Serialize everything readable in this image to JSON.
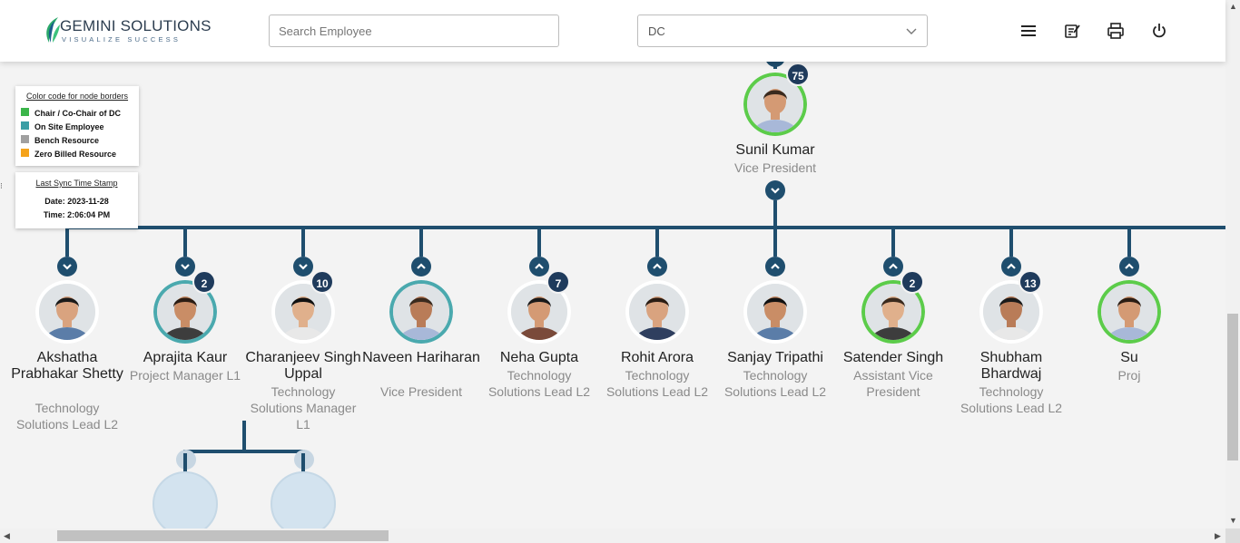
{
  "header": {
    "logo_text": "GEMINI SOLUTIONS",
    "logo_tagline": "VISUALIZE SUCCESS",
    "search_placeholder": "Search Employee",
    "select_value": "DC",
    "icons": [
      "menu-icon",
      "notes-icon",
      "print-icon",
      "power-icon"
    ]
  },
  "legend": {
    "title": "Color code for node borders",
    "items": [
      {
        "label": "Chair / Co-Chair of DC",
        "color": "#3bb54a"
      },
      {
        "label": "On Site Employee",
        "color": "#3a9ea5"
      },
      {
        "label": "Bench Resource",
        "color": "#a0a0a0"
      },
      {
        "label": "Zero Billed Resource",
        "color": "#f5a31a"
      }
    ]
  },
  "sync": {
    "title": "Last Sync Time Stamp",
    "date": "Date: 2023-11-28",
    "time": "Time: 2:06:04 PM"
  },
  "root": {
    "name": "Sunil Kumar",
    "title": "Vice President",
    "count": "75",
    "border": "#5ccc4a"
  },
  "employees": [
    {
      "name": "Akshatha Prabhakar Shetty",
      "title": "Technology Solutions Lead L2",
      "count": "",
      "border": "#ffffff"
    },
    {
      "name": "Aprajita Kaur",
      "title": "Project Manager L1",
      "count": "2",
      "border": "#4aa9ae"
    },
    {
      "name": "Charanjeev Singh Uppal",
      "title": "Technology Solutions Manager L1",
      "count": "10",
      "border": "#ffffff"
    },
    {
      "name": "Naveen Hariharan",
      "title": "Vice President",
      "count": "",
      "border": "#4aa9ae"
    },
    {
      "name": "Neha Gupta",
      "title": "Technology Solutions Lead L2",
      "count": "7",
      "border": "#ffffff"
    },
    {
      "name": "Rohit Arora",
      "title": "Technology Solutions Lead L2",
      "count": "",
      "border": "#ffffff"
    },
    {
      "name": "Sanjay Tripathi",
      "title": "Technology Solutions Lead L2",
      "count": "",
      "border": "#ffffff"
    },
    {
      "name": "Satender Singh",
      "title": "Assistant Vice President",
      "count": "2",
      "border": "#5ccc4a"
    },
    {
      "name": "Shubham Bhardwaj",
      "title": "Technology Solutions Lead L2",
      "count": "13",
      "border": "#ffffff"
    },
    {
      "name": "Su",
      "title": "Proj",
      "count": "",
      "border": "#5ccc4a"
    }
  ]
}
